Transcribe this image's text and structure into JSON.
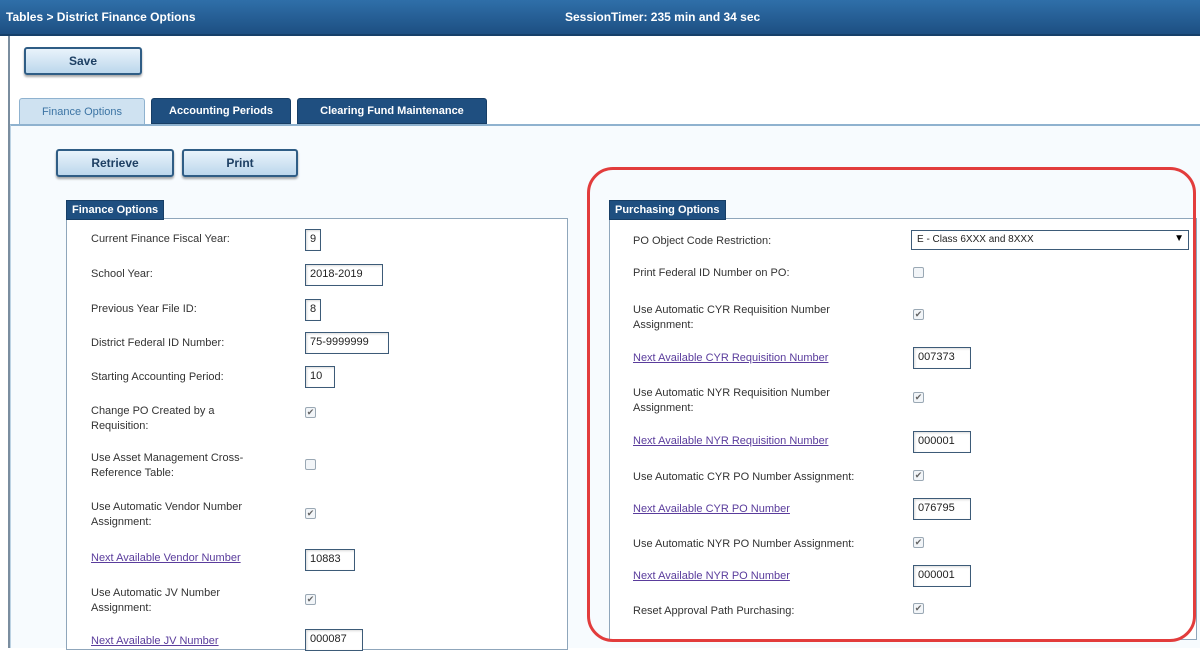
{
  "header": {
    "breadcrumb": "Tables > District Finance Options",
    "session_timer": "SessionTimer: 235 min and 34 sec"
  },
  "toolbar": {
    "save_label": "Save"
  },
  "tabs": [
    {
      "label": "Finance Options",
      "active": true
    },
    {
      "label": "Accounting Periods",
      "active": false
    },
    {
      "label": "Clearing Fund Maintenance",
      "active": false
    }
  ],
  "actions": {
    "retrieve_label": "Retrieve",
    "print_label": "Print"
  },
  "finance_options": {
    "title": "Finance Options",
    "current_fiscal_year": {
      "label": "Current Finance Fiscal Year:",
      "value": "9"
    },
    "school_year": {
      "label": "School Year:",
      "value": "2018-2019"
    },
    "prev_year_file_id": {
      "label": "Previous Year File ID:",
      "value": "8"
    },
    "district_federal_id": {
      "label": "District Federal ID Number:",
      "value": "75-9999999"
    },
    "starting_period": {
      "label": "Starting Accounting Period:",
      "value": "10"
    },
    "change_po": {
      "label_line1": "Change PO Created by a",
      "label_line2": "Requisition:",
      "checked": true
    },
    "asset_mgmt": {
      "label_line1": "Use Asset Management Cross-",
      "label_line2": "Reference Table:",
      "checked": false
    },
    "auto_vendor": {
      "label_line1": "Use Automatic Vendor Number",
      "label_line2": "Assignment:",
      "checked": true
    },
    "next_vendor": {
      "label": "Next Available Vendor Number",
      "value": "10883"
    },
    "auto_jv": {
      "label_line1": "Use Automatic JV Number",
      "label_line2": "Assignment:",
      "checked": true
    },
    "next_jv": {
      "label": "Next Available JV Number",
      "value": "000087"
    }
  },
  "purchasing_options": {
    "title": "Purchasing Options",
    "po_object_code": {
      "label": "PO Object Code Restriction:",
      "value": "E - Class 6XXX and 8XXX"
    },
    "print_federal_id": {
      "label": "Print Federal ID Number on PO:",
      "checked": false
    },
    "auto_cyr_req": {
      "label_line1": "Use Automatic CYR Requisition Number",
      "label_line2": "Assignment:",
      "checked": true
    },
    "next_cyr_req": {
      "label": "Next Available CYR Requisition Number",
      "value": "007373"
    },
    "auto_nyr_req": {
      "label_line1": "Use Automatic NYR Requisition Number",
      "label_line2": "Assignment:",
      "checked": true
    },
    "next_nyr_req": {
      "label": "Next Available NYR Requisition Number",
      "value": "000001"
    },
    "auto_cyr_po": {
      "label": "Use Automatic CYR PO Number Assignment:",
      "checked": true
    },
    "next_cyr_po": {
      "label": "Next Available CYR PO Number",
      "value": "076795"
    },
    "auto_nyr_po": {
      "label": "Use Automatic NYR PO Number Assignment:",
      "checked": true
    },
    "next_nyr_po": {
      "label": "Next Available NYR PO Number",
      "value": "000001"
    },
    "reset_approval": {
      "label": "Reset Approval Path Purchasing:",
      "checked": true
    }
  },
  "colors": {
    "header_bg": "#1d4f82",
    "link": "#5a3c9c",
    "highlight": "#e23c3c"
  }
}
